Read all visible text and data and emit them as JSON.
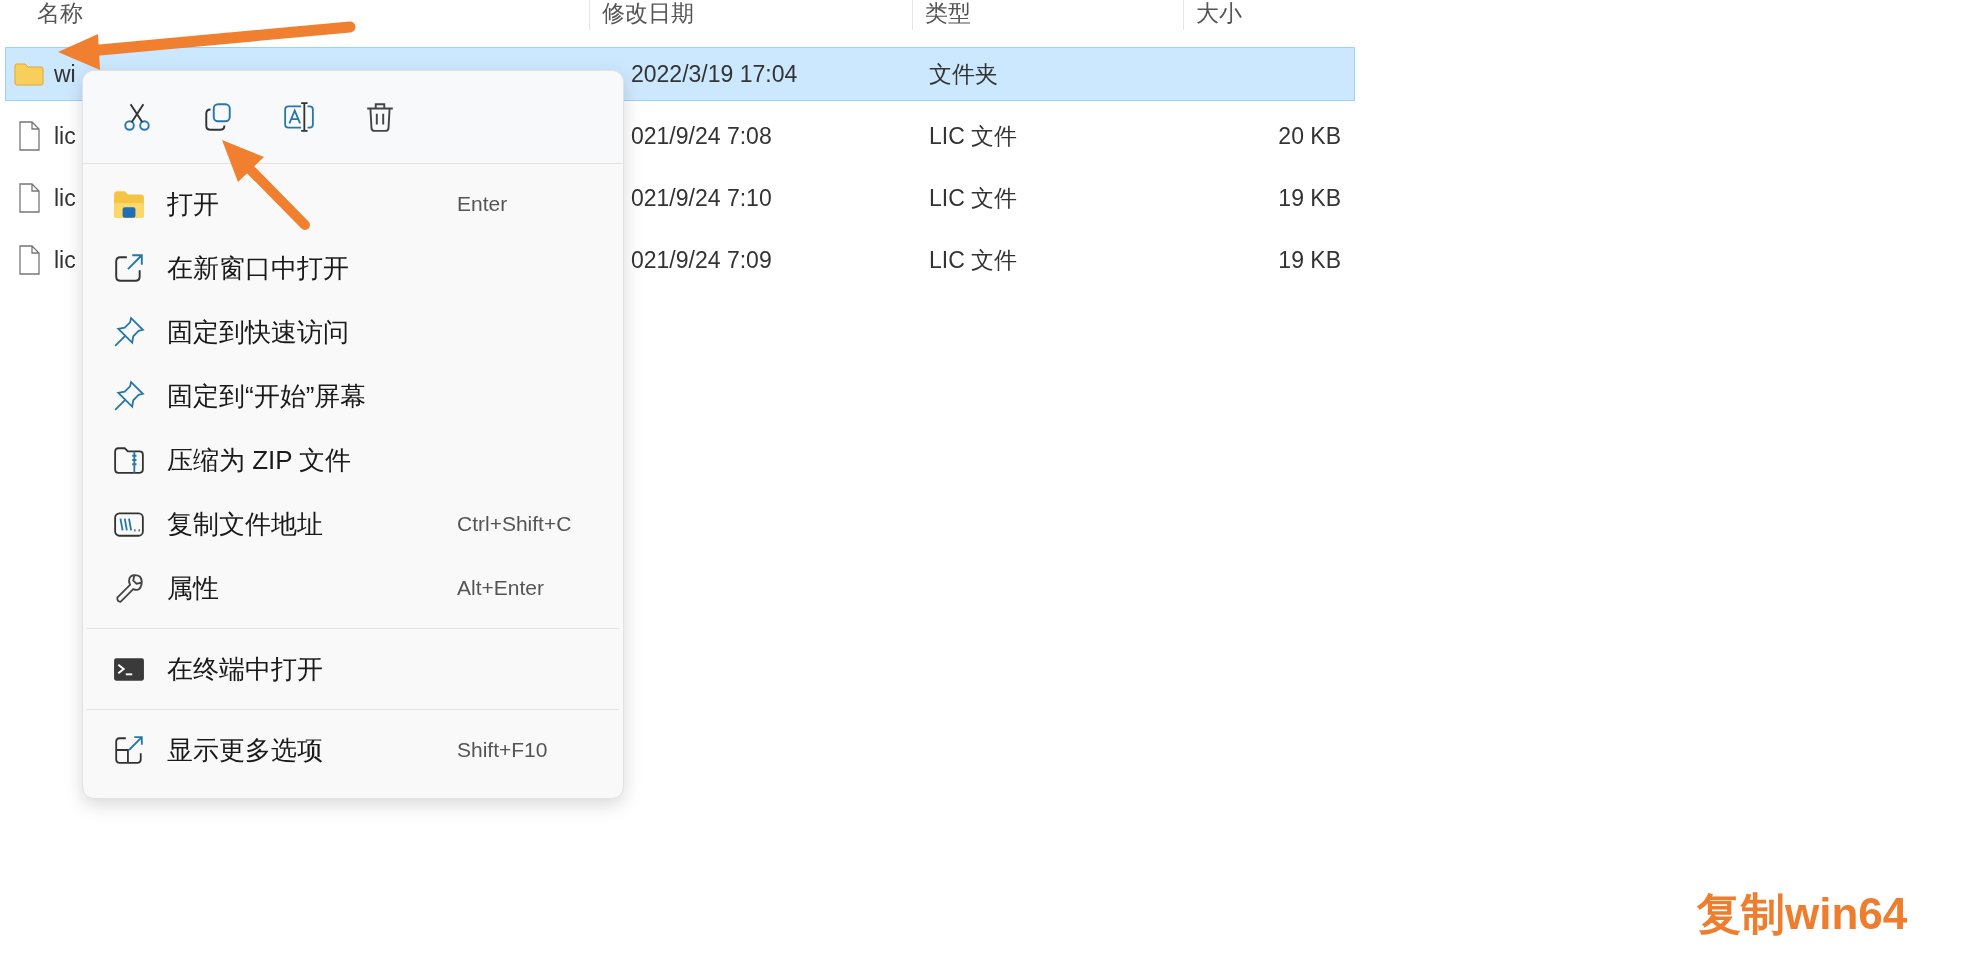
{
  "columns": [
    "名称",
    "修改日期",
    "类型",
    "大小"
  ],
  "files": [
    {
      "kind": "folder",
      "name": "wi",
      "date": "2022/3/19 17:04",
      "type": "文件夹",
      "selected": true
    },
    {
      "kind": "file",
      "name": "lic",
      "date": "021/9/24 7:08",
      "type": "LIC 文件",
      "size": "20 KB",
      "selected": false
    },
    {
      "kind": "file",
      "name": "lic",
      "date": "021/9/24 7:10",
      "type": "LIC 文件",
      "size": "19 KB",
      "selected": false
    },
    {
      "kind": "file",
      "name": "lic",
      "date": "021/9/24 7:09",
      "type": "LIC 文件",
      "size": "19 KB",
      "selected": false
    }
  ],
  "context_menu": {
    "toolbar": [
      {
        "kind": "cut"
      },
      {
        "kind": "copy"
      },
      {
        "kind": "rename"
      },
      {
        "kind": "delete"
      }
    ],
    "groups": [
      [
        {
          "kind": "open",
          "label": "打开",
          "shortcut": "Enter"
        },
        {
          "kind": "new-window",
          "label": "在新窗口中打开"
        },
        {
          "kind": "pin",
          "label": "固定到快速访问"
        },
        {
          "kind": "pin",
          "label": "固定到“开始”屏幕"
        },
        {
          "kind": "zip",
          "label": "压缩为 ZIP 文件"
        },
        {
          "kind": "copy-path",
          "label": "复制文件地址",
          "shortcut": "Ctrl+Shift+C"
        },
        {
          "kind": "properties",
          "label": "属性",
          "shortcut": "Alt+Enter"
        }
      ],
      [
        {
          "kind": "terminal",
          "label": "在终端中打开"
        }
      ],
      [
        {
          "kind": "more",
          "label": "显示更多选项",
          "shortcut": "Shift+F10"
        }
      ]
    ]
  },
  "caption": "复制win64"
}
